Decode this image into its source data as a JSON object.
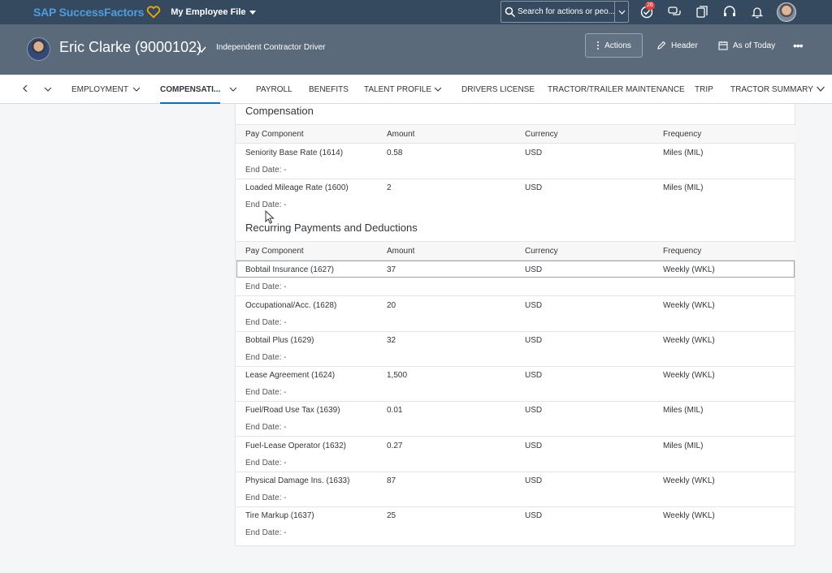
{
  "shell": {
    "brand": "SAP SuccessFactors",
    "app_menu": "My Employee File",
    "search_placeholder": "Search for actions or peo...",
    "notification_count": "26",
    "brand_color": "#4d9de0",
    "shell_color": "#354a5f"
  },
  "header": {
    "employee_name": "Eric Clarke (9000102)",
    "employee_title": "Independent Contractor Driver",
    "actions_label": "Actions",
    "header_label": "Header",
    "as_of_label": "As of Today",
    "more_label": "•••"
  },
  "tabs": [
    {
      "label": "EMPLOYMENT"
    },
    {
      "label": "COMPENSATI..."
    },
    {
      "label": "PAYROLL"
    },
    {
      "label": "BENEFITS"
    },
    {
      "label": "TALENT PROFILE"
    },
    {
      "label": "DRIVERS LICENSE"
    },
    {
      "label": "TRACTOR/TRAILER MAINTENANCE"
    },
    {
      "label": "TRIP"
    },
    {
      "label": "TRACTOR SUMMARY"
    }
  ],
  "compensation": {
    "title": "Compensation",
    "columns": [
      "Pay Component",
      "Amount",
      "Currency",
      "Frequency"
    ],
    "rows": [
      {
        "component": "Seniority Base Rate (1614)",
        "amount": "0.58",
        "currency": "USD",
        "frequency": "Miles (MIL)",
        "end_date": "End Date:  -"
      },
      {
        "component": "Loaded Mileage Rate (1600)",
        "amount": "2",
        "currency": "USD",
        "frequency": "Miles (MIL)",
        "end_date": "End Date:  -"
      }
    ]
  },
  "recurring": {
    "title": "Recurring Payments and Deductions",
    "columns": [
      "Pay Component",
      "Amount",
      "Currency",
      "Frequency"
    ],
    "rows": [
      {
        "component": "Bobtail Insurance (1627)",
        "amount": "37",
        "currency": "USD",
        "frequency": "Weekly (WKL)",
        "end_date": "End Date:  -"
      },
      {
        "component": "Occupational/Acc. (1628)",
        "amount": "20",
        "currency": "USD",
        "frequency": "Weekly (WKL)",
        "end_date": "End Date:  -"
      },
      {
        "component": "Bobtail Plus (1629)",
        "amount": "32",
        "currency": "USD",
        "frequency": "Weekly (WKL)",
        "end_date": "End Date:  -"
      },
      {
        "component": "Lease Agreement (1624)",
        "amount": "1,500",
        "currency": "USD",
        "frequency": "Weekly (WKL)",
        "end_date": "End Date:  -"
      },
      {
        "component": "Fuel/Road Use Tax (1639)",
        "amount": "0.01",
        "currency": "USD",
        "frequency": "Miles (MIL)",
        "end_date": "End Date:  -"
      },
      {
        "component": "Fuel-Lease Operator (1632)",
        "amount": "0.27",
        "currency": "USD",
        "frequency": "Miles (MIL)",
        "end_date": "End Date:  -"
      },
      {
        "component": "Physical Damage Ins. (1633)",
        "amount": "87",
        "currency": "USD",
        "frequency": "Weekly (WKL)",
        "end_date": "End Date:  -"
      },
      {
        "component": "Tire Markup (1637)",
        "amount": "25",
        "currency": "USD",
        "frequency": "Weekly (WKL)",
        "end_date": "End Date:  -"
      }
    ]
  }
}
